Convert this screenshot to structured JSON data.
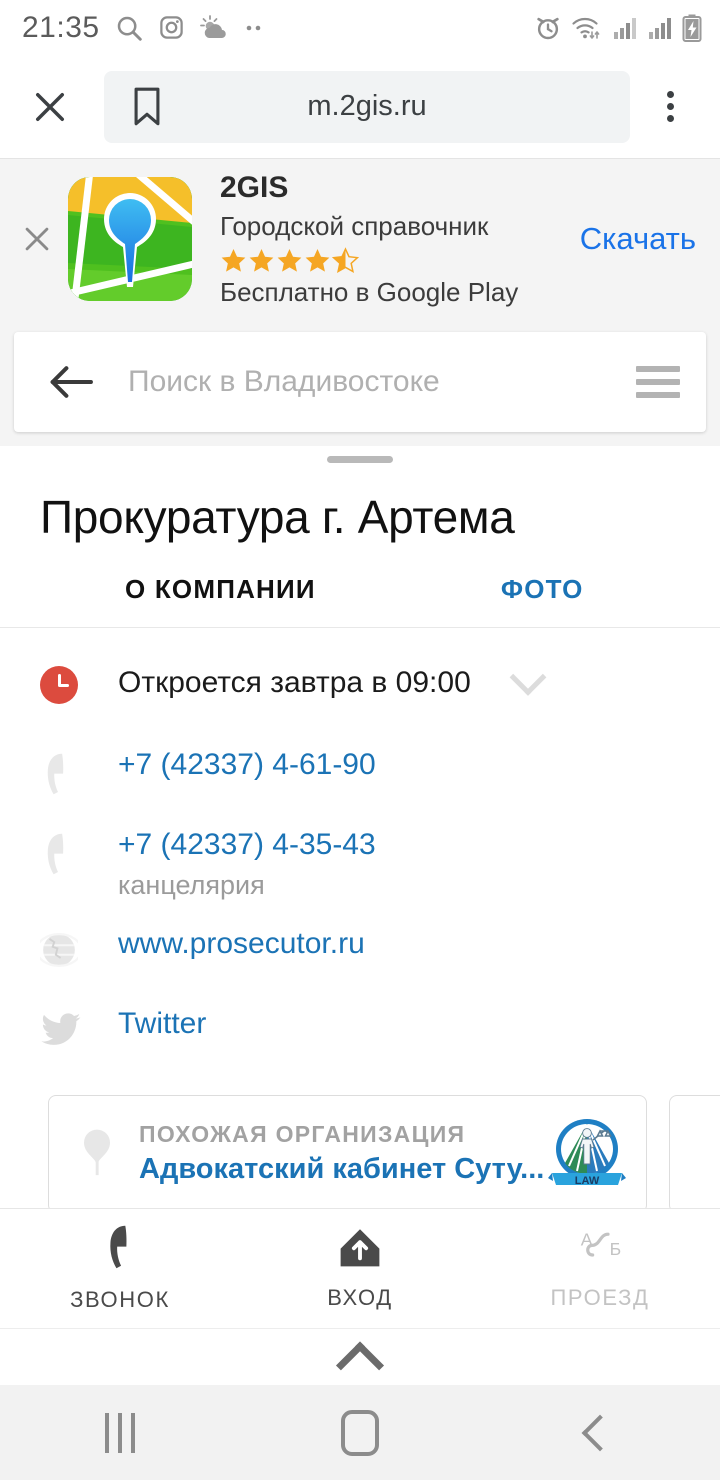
{
  "status_bar": {
    "time": "21:35",
    "left_icons": [
      "search-icon",
      "instagram-icon",
      "weather-icon",
      "more-dots-icon"
    ],
    "right_icons": [
      "alarm-icon",
      "wifi-icon",
      "signal-icon-1",
      "signal-icon-2",
      "battery-charging-icon"
    ]
  },
  "browser": {
    "close_label": "close-icon",
    "bookmark_label": "bookmark-icon",
    "url": "m.2gis.ru",
    "menu_label": "overflow-menu-icon"
  },
  "app_banner": {
    "close_label": "×",
    "app_name": "2GIS",
    "subtitle": "Городской справочник",
    "rating": 4.5,
    "stars_full": 4,
    "stars_half": 1,
    "price_line": "Бесплатно в Google Play",
    "action_label": "Скачать",
    "action_color": "#1a73e8",
    "star_color": "#f5a623"
  },
  "search": {
    "placeholder": "Поиск в Владивостоке",
    "value": "",
    "back_icon": "arrow-left-icon",
    "menu_icon": "hamburger-menu-icon"
  },
  "org": {
    "title": "Прокуратура г. Артема",
    "tabs": [
      {
        "label": "О КОМПАНИИ",
        "active": true
      },
      {
        "label": "ФОТО",
        "active": false
      }
    ],
    "schedule": {
      "text": "Откроется завтра в 09:00",
      "icon": "clock-icon",
      "icon_color": "#dc4b3e",
      "expand_icon": "chevron-down-icon"
    },
    "contacts": [
      {
        "type": "phone",
        "value": "+7 (42337) 4-61-90",
        "note": ""
      },
      {
        "type": "phone",
        "value": "+7 (42337) 4-35-43",
        "note": "канцелярия"
      },
      {
        "type": "website",
        "value": "www.prosecutor.ru",
        "note": ""
      },
      {
        "type": "social",
        "value": "Twitter",
        "note": ""
      }
    ],
    "link_color": "#1b73b5"
  },
  "similar": {
    "kicker": "ПОХОЖАЯ ОРГАНИЗАЦИЯ",
    "name": "Адвокатский кабинет Суту...",
    "logo_text": "LAW"
  },
  "actions": [
    {
      "label": "ЗВОНОК",
      "icon": "phone-icon",
      "disabled": false
    },
    {
      "label": "ВХОД",
      "icon": "entrance-icon",
      "disabled": false
    },
    {
      "label": "ПРОЕЗД",
      "icon": "route-ab-icon",
      "disabled": true
    }
  ],
  "sheet": {
    "collapse_icon": "chevron-up-icon"
  },
  "android_nav": {
    "recents": "recents-icon",
    "home": "home-icon",
    "back": "back-icon"
  }
}
